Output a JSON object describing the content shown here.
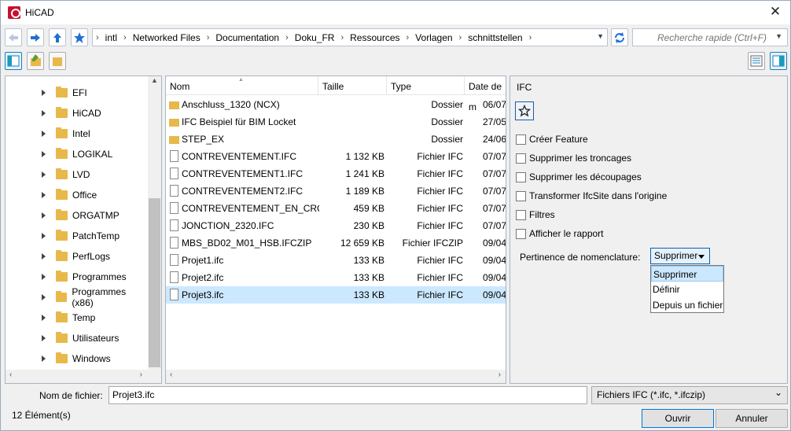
{
  "window": {
    "title": "HiCAD",
    "close_glyph": "✕"
  },
  "navigation": {
    "back_icon": "back-arrow-icon",
    "forward_icon": "forward-arrow-icon",
    "up_icon": "up-arrow-icon",
    "favorites_icon": "star-icon",
    "path": [
      "intl",
      "Networked Files",
      "Documentation",
      "Doku_FR",
      "Ressources",
      "Vorlagen",
      "schnittstellen"
    ],
    "refresh_icon": "refresh-icon",
    "search_placeholder": "Recherche rapide (Ctrl+F)"
  },
  "tree": {
    "items": [
      {
        "label": "EFI"
      },
      {
        "label": "HiCAD"
      },
      {
        "label": "Intel"
      },
      {
        "label": "LOGIKAL"
      },
      {
        "label": "LVD"
      },
      {
        "label": "Office"
      },
      {
        "label": "ORGATMP"
      },
      {
        "label": "PatchTemp"
      },
      {
        "label": "PerfLogs"
      },
      {
        "label": "Programmes"
      },
      {
        "label": "Programmes (x86)"
      },
      {
        "label": "Temp"
      },
      {
        "label": "Utilisateurs"
      },
      {
        "label": "Windows"
      }
    ]
  },
  "files": {
    "columns": {
      "name": "Nom",
      "size": "Taille",
      "type": "Type",
      "date": "Date de m"
    },
    "rows": [
      {
        "kind": "folder",
        "name": "Anschluss_1320 (NCX)",
        "size": "",
        "type": "Dossier",
        "date": "06/07"
      },
      {
        "kind": "folder",
        "name": "IFC Beispiel für BIM Locket",
        "size": "",
        "type": "Dossier",
        "date": "27/05"
      },
      {
        "kind": "folder",
        "name": "STEP_EX",
        "size": "",
        "type": "Dossier",
        "date": "24/06"
      },
      {
        "kind": "file",
        "name": "CONTREVENTEMENT.IFC",
        "size": "1 132 KB",
        "type": "Fichier IFC",
        "date": "07/07"
      },
      {
        "kind": "file",
        "name": "CONTREVENTEMENT1.IFC",
        "size": "1 241 KB",
        "type": "Fichier IFC",
        "date": "07/07"
      },
      {
        "kind": "file",
        "name": "CONTREVENTEMENT2.IFC",
        "size": "1 189 KB",
        "type": "Fichier IFC",
        "date": "07/07"
      },
      {
        "kind": "file",
        "name": "CONTREVENTEMENT_EN_CRO...",
        "size": "459 KB",
        "type": "Fichier IFC",
        "date": "07/07"
      },
      {
        "kind": "file",
        "name": "JONCTION_2320.IFC",
        "size": "230 KB",
        "type": "Fichier IFC",
        "date": "07/07"
      },
      {
        "kind": "file",
        "name": "MBS_BD02_M01_HSB.IFCZIP",
        "size": "12 659 KB",
        "type": "Fichier IFCZIP",
        "date": "09/04"
      },
      {
        "kind": "file",
        "name": "Projet1.ifc",
        "size": "133 KB",
        "type": "Fichier IFC",
        "date": "09/04"
      },
      {
        "kind": "file",
        "name": "Projet2.ifc",
        "size": "133 KB",
        "type": "Fichier IFC",
        "date": "09/04"
      },
      {
        "kind": "file",
        "name": "Projet3.ifc",
        "size": "133 KB",
        "type": "Fichier IFC",
        "date": "09/04",
        "selected": true
      }
    ]
  },
  "ifc_panel": {
    "title": "IFC",
    "options": [
      {
        "label": "Créer Feature",
        "checked": false
      },
      {
        "label": "Supprimer les troncages",
        "checked": false
      },
      {
        "label": "Supprimer les découpages",
        "checked": false
      },
      {
        "label": "Transformer IfcSite dans l'origine",
        "checked": false
      },
      {
        "label": "Filtres",
        "checked": false
      },
      {
        "label": "Afficher le rapport",
        "checked": false
      }
    ],
    "pertinence_label": "Pertinence de nomenclature:",
    "pertinence_value": "Supprimer",
    "pertinence_options": [
      "Supprimer",
      "Définir",
      "Depuis un fichier"
    ]
  },
  "footer": {
    "filename_label": "Nom de fichier:",
    "filename_value": "Projet3.ifc",
    "filetype_value": "Fichiers IFC (*.ifc, *.ifczip)",
    "item_count": "12 Élément(s)",
    "open_label": "Ouvrir",
    "cancel_label": "Annuler"
  },
  "colors": {
    "accent": "#0078d7",
    "selection": "#cce8ff",
    "folder": "#e8b84a",
    "app_icon": "#c8102e"
  }
}
